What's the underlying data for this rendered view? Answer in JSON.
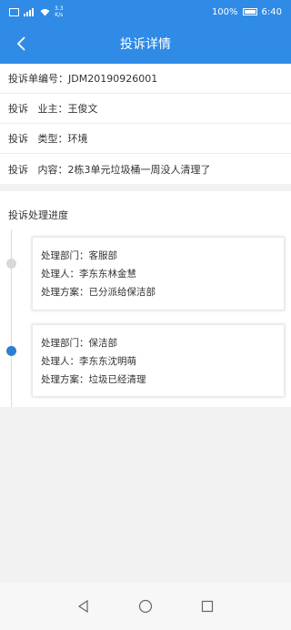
{
  "statusbar": {
    "speed_top": "3.3",
    "speed_bottom": "K/s",
    "battery": "100%",
    "time": "6:40"
  },
  "header": {
    "title": "投诉详情"
  },
  "complaint": {
    "number_label": "投诉单编号：",
    "number_value": "JDM20190926001",
    "owner_label": "投诉   业主：",
    "owner_value": "王俊文",
    "type_label": "投诉   类型：",
    "type_value": "环境",
    "content_label": "投诉   内容：",
    "content_value": "2栋3单元垃圾桶一周没人清理了"
  },
  "progress": {
    "title": "投诉处理进度",
    "steps": [
      {
        "dept_label": "处理部门：",
        "dept_value": "客服部",
        "handler_label": "处理人：",
        "handler_value": "李东东林金慧",
        "plan_label": "处理方案：",
        "plan_value": "已分派给保洁部"
      },
      {
        "dept_label": "处理部门：",
        "dept_value": "保洁部",
        "handler_label": "处理人：",
        "handler_value": "李东东沈明萌",
        "plan_label": "处理方案：",
        "plan_value": "垃圾已经清理"
      }
    ]
  },
  "colors": {
    "primary": "#2f8be6",
    "timeline_active": "#2f7fd0",
    "timeline_inactive": "#d8d8d8"
  },
  "icons": {
    "back": "chevron-left-icon",
    "nav_back": "triangle-back-icon",
    "nav_home": "circle-home-icon",
    "nav_recent": "square-recent-icon"
  }
}
